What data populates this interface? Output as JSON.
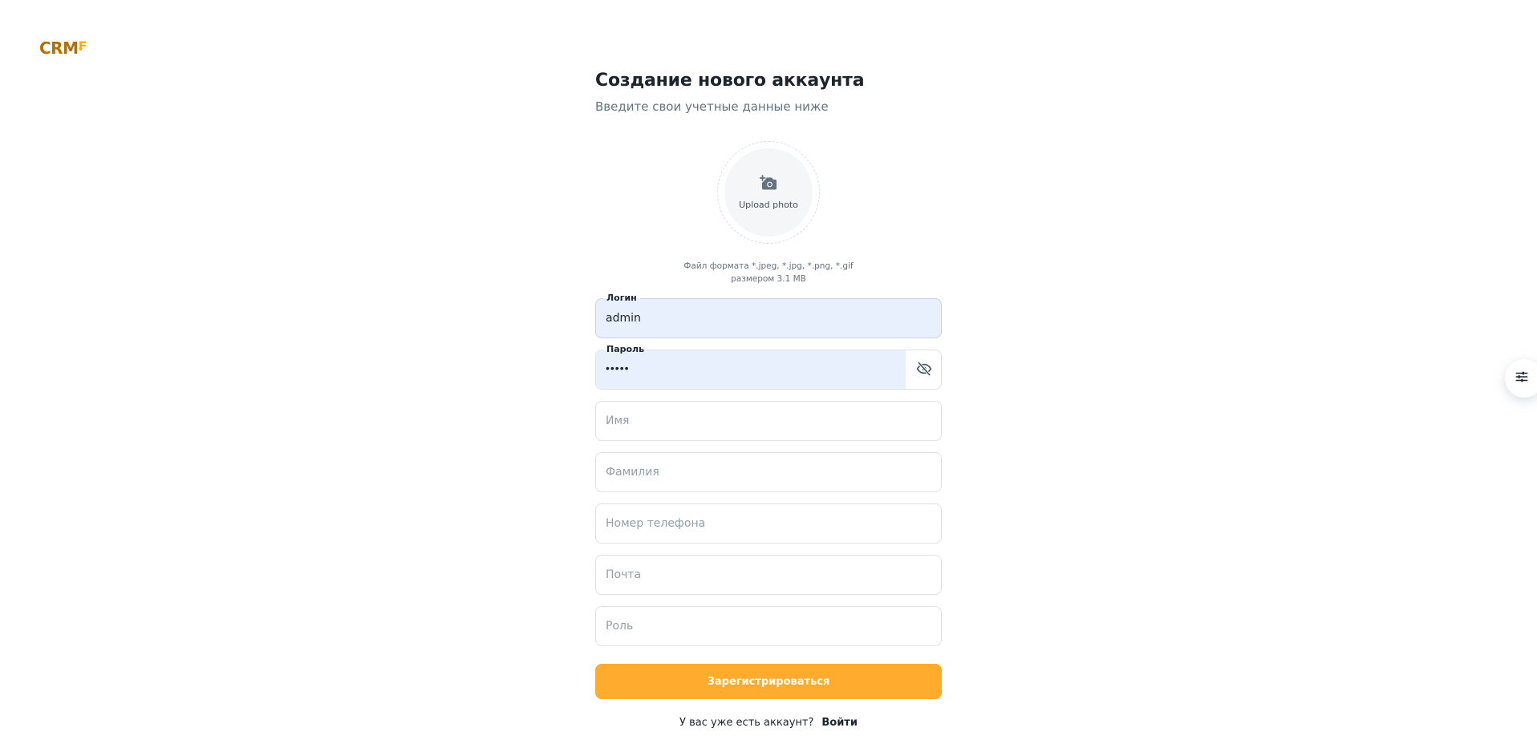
{
  "logo": {
    "text": "CRM",
    "accent": "₣"
  },
  "header": {
    "title": "Создание нового аккаунта",
    "subtitle": "Введите свои учетные данные ниже"
  },
  "upload": {
    "label": "Upload photo",
    "icon": "camera-add-icon",
    "helper_line1": "Файл формата *.jpeg, *.jpg, *.png, *.gif",
    "helper_line2": "размером 3.1 MB"
  },
  "fields": {
    "login": {
      "label": "Логин",
      "value": "admin"
    },
    "password": {
      "label": "Пароль",
      "value": "•••••",
      "toggle_icon": "eye-off-icon"
    },
    "first_name": {
      "placeholder": "Имя"
    },
    "last_name": {
      "placeholder": "Фамилия"
    },
    "phone": {
      "placeholder": "Номер телефона"
    },
    "email": {
      "placeholder": "Почта"
    },
    "role": {
      "placeholder": "Роль"
    }
  },
  "submit": {
    "label": "Зарегистрироваться"
  },
  "footer": {
    "prompt": "У вас уже есть аккаунт?",
    "link": "Войти"
  },
  "settings": {
    "icon": "settings-sliders-icon"
  },
  "colors": {
    "accent": "#ffab2e",
    "brand": "#b76e00",
    "autofill": "#e8f0fe"
  }
}
